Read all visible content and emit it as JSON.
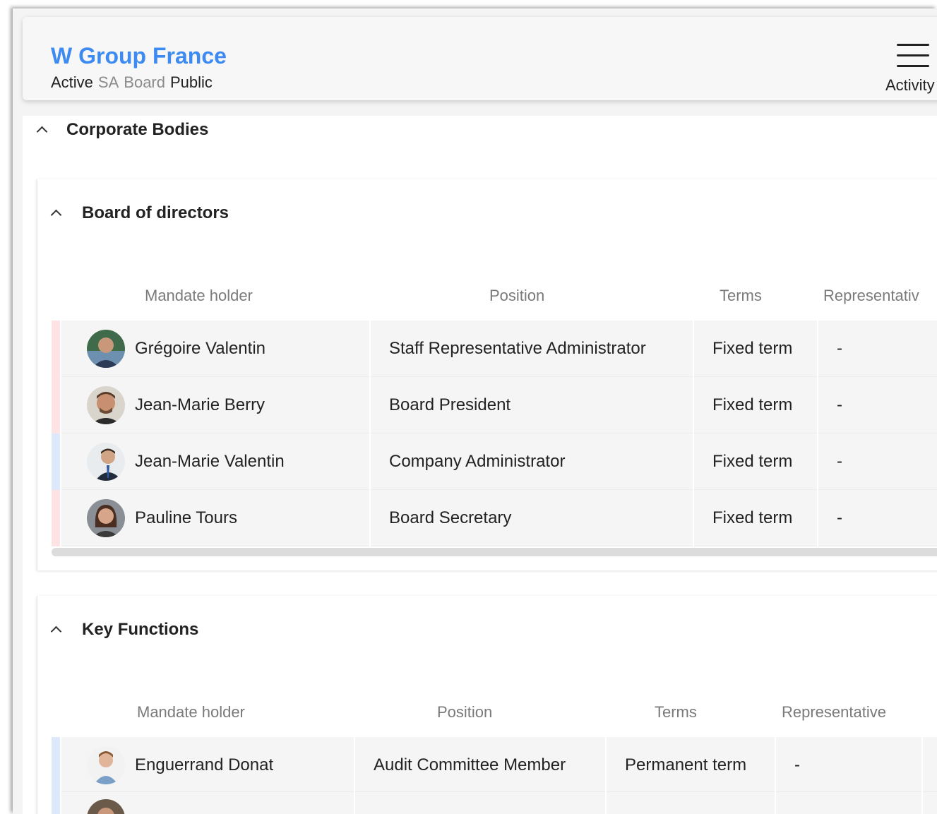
{
  "header": {
    "company_name": "W Group France",
    "tags": [
      {
        "text": "Active",
        "style": "dark"
      },
      {
        "text": "SA",
        "style": "light"
      },
      {
        "text": "Board",
        "style": "light"
      },
      {
        "text": "Public",
        "style": "dark"
      }
    ],
    "activity_label": "Activity"
  },
  "corporate_bodies": {
    "title": "Corporate Bodies",
    "board": {
      "title": "Board of directors",
      "columns": [
        "Mandate holder",
        "Position",
        "Terms",
        "Representativ"
      ],
      "rows": [
        {
          "name": "Grégoire Valentin",
          "position": "Staff Representative Administrator",
          "terms": "Fixed term",
          "representative": "-",
          "accent": "#fde3e4"
        },
        {
          "name": "Jean-Marie Berry",
          "position": "Board President",
          "terms": "Fixed term",
          "representative": "-",
          "accent": "#fde3e4"
        },
        {
          "name": "Jean-Marie Valentin",
          "position": "Company Administrator",
          "terms": "Fixed term",
          "representative": "-",
          "accent": "#dde9fb"
        },
        {
          "name": "Pauline Tours",
          "position": "Board Secretary",
          "terms": "Fixed term",
          "representative": "-",
          "accent": "#fde3e4"
        }
      ]
    },
    "key_functions": {
      "title": "Key Functions",
      "columns": [
        "Mandate holder",
        "Position",
        "Terms",
        "Representative"
      ],
      "rows": [
        {
          "name": "Enguerrand Donat",
          "position": "Audit Committee Member",
          "terms": "Permanent term",
          "representative": "-",
          "accent": "#dde9fb"
        },
        {
          "name": "",
          "position": "",
          "terms": "",
          "representative": "",
          "accent": "#dde9fb"
        }
      ]
    }
  },
  "colors": {
    "brand_blue": "#3d8bf2",
    "accent_female": "#fde3e4",
    "accent_male": "#dde9fb"
  }
}
